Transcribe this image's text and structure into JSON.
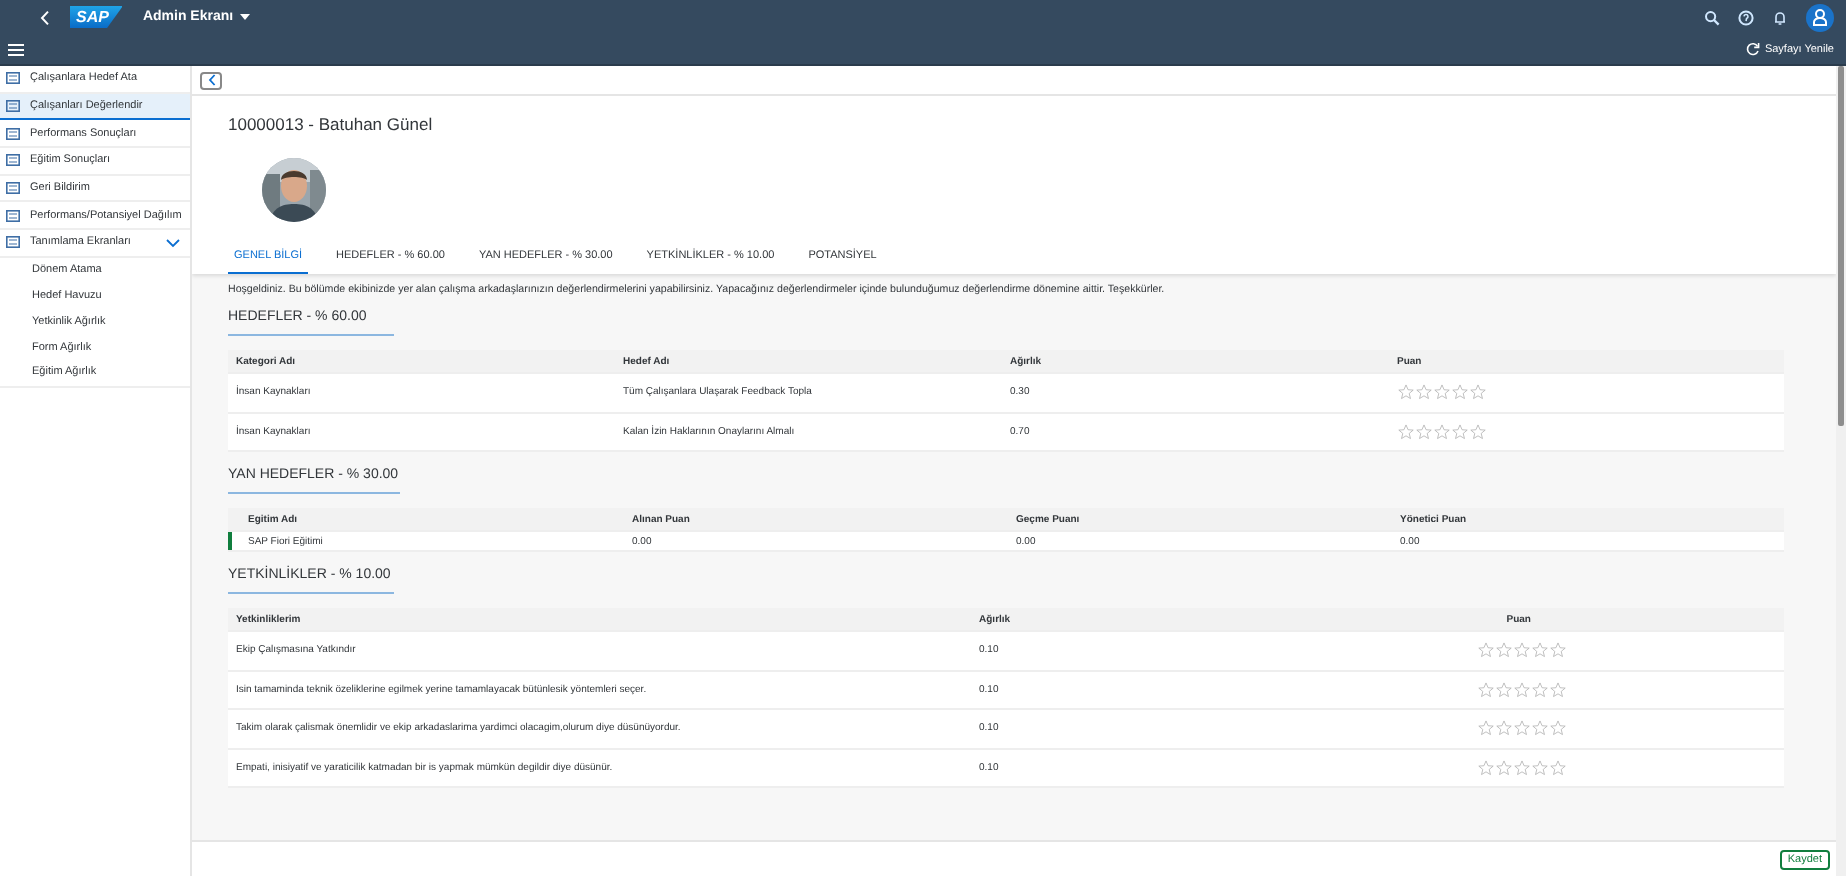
{
  "shell": {
    "logo": "SAP",
    "title": "Admin Ekranı",
    "refresh": "Sayfayı Yenile"
  },
  "sidebar": {
    "items": [
      {
        "label": "Çalışanlara Hedef Ata",
        "selected": false
      },
      {
        "label": "Çalışanları Değerlendir",
        "selected": true
      },
      {
        "label": "Performans Sonuçları",
        "selected": false
      },
      {
        "label": "Eğitim Sonuçları",
        "selected": false
      },
      {
        "label": "Geri Bildirim",
        "selected": false
      },
      {
        "label": "Performans/Potansiyel Dağılım",
        "selected": false
      },
      {
        "label": "Tanımlama Ekranları",
        "selected": false,
        "expanded": true,
        "children": [
          {
            "label": "Dönem Atama",
            "selected": false
          },
          {
            "label": "Hedef Havuzu",
            "selected": false
          },
          {
            "label": "Yetkinlik Ağırlık",
            "selected": false
          },
          {
            "label": "Form Ağırlık",
            "selected": false
          },
          {
            "label": "Eğitim Ağırlık",
            "selected": false
          }
        ]
      }
    ]
  },
  "page": {
    "title": "10000013 - Batuhan Günel",
    "tabs": [
      {
        "label": "GENEL BİLGİ",
        "selected": true
      },
      {
        "label": "HEDEFLER - % 60.00",
        "selected": false
      },
      {
        "label": "YAN HEDEFLER - % 30.00",
        "selected": false
      },
      {
        "label": "YETKİNLİKLER - % 10.00",
        "selected": false
      },
      {
        "label": "POTANSİYEL",
        "selected": false
      }
    ],
    "intro": "Hoşgeldiniz. Bu bölümde ekibinizde yer alan çalışma arkadaşlarınızın değerlendirmelerini yapabilirsiniz. Yapacağınız değerlendirmeler içinde bulunduğumuz değerlendirme dönemine aittir. Teşekkürler.",
    "sections": [
      {
        "title": "HEDEFLER - % 60.00",
        "kind": "goals",
        "columns": [
          "Kategori Adı",
          "Hedef Adı",
          "Ağırlık",
          "Puan"
        ],
        "rows": [
          {
            "cells": [
              "İnsan Kaynakları",
              "Tüm Çalışanlara Ulaşarak Feedback Topla",
              "0.30"
            ],
            "stars": 0
          },
          {
            "cells": [
              "İnsan Kaynakları",
              "Kalan İzin Haklarının Onaylarını Almalı",
              "0.70"
            ],
            "stars": 0
          }
        ]
      },
      {
        "title": "YAN HEDEFLER - % 30.00",
        "kind": "training",
        "columns": [
          "Egitim Adı",
          "Alınan Puan",
          "Geçme Puanı",
          "Yönetici Puan"
        ],
        "rows": [
          {
            "cells": [
              "SAP Fiori Eğitimi",
              "0.00",
              "0.00",
              "0.00"
            ],
            "color": "#107e3e"
          }
        ]
      },
      {
        "title": "YETKİNLİKLER - % 10.00",
        "kind": "skills",
        "columns": [
          "Yetkinliklerim",
          "Ağırlık",
          "Puan"
        ],
        "rows": [
          {
            "cells": [
              "Ekip Çalışmasına Yatkındır",
              "0.10"
            ],
            "stars": 0
          },
          {
            "cells": [
              "Isin tamaminda teknik özeliklerine egilmek yerine tamamlayacak bütünlesik yöntemleri seçer.",
              "0.10"
            ],
            "stars": 0
          },
          {
            "cells": [
              "Takim olarak çalismak önemlidir ve ekip arkadaslarima yardimci olacagim,olurum diye düsünüyordur.",
              "0.10"
            ],
            "stars": 0
          },
          {
            "cells": [
              "Empati, inisiyatif ve yaraticilik katmadan bir is yapmak mümkün degildir diye düsünür.",
              "0.10"
            ],
            "stars": 0
          }
        ]
      }
    ],
    "save": "Kaydet"
  }
}
